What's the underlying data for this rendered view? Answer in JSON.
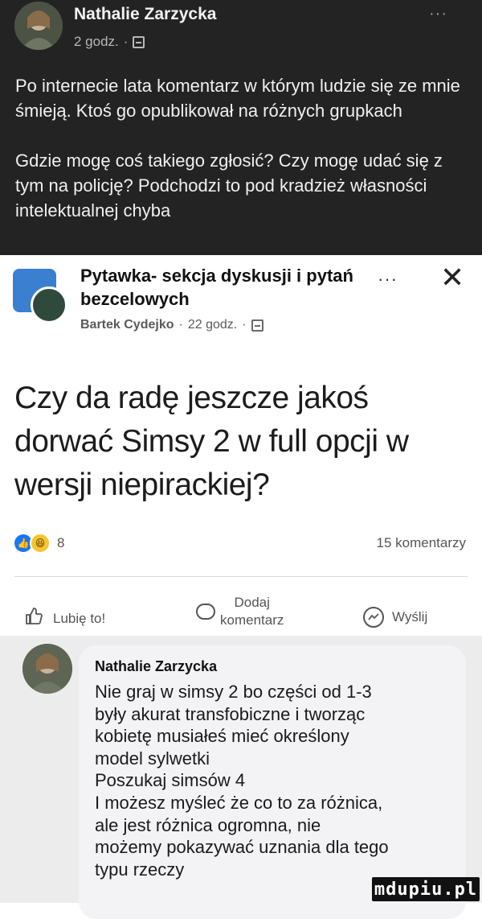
{
  "top_post": {
    "author": "Nathalie Zarzycka",
    "time": "2 godz.",
    "separator": "·",
    "more": "···",
    "paragraph1": "Po internecie lata komentarz w którym ludzie się ze mnie śmieją. Ktoś go opublikował na różnych grupkach",
    "paragraph2": "Gdzie mogę coś takiego zgłosić? Czy mogę udać się z tym na policję? Podchodzi to pod kradzież własności intelektualnej chyba"
  },
  "shared_post": {
    "group_name": "Pytawka- sekcja dyskusji i pytań bezcelowych",
    "author": "Bartek Cydejko",
    "time": "22 godz.",
    "separator": "·",
    "more": "···",
    "close": "✕",
    "question": "Czy da radę jeszcze jakoś dorwać Simsy 2 w full opcji w wersji niepirackiej?",
    "reactions_count": "8",
    "comments_count": "15 komentarzy",
    "actions": {
      "like": "Lubię to!",
      "comment_line1": "Dodaj",
      "comment_line2": "komentarz",
      "share": "Wyślij"
    }
  },
  "comment": {
    "author": "Nathalie Zarzycka",
    "lines": [
      "Nie graj w simsy 2 bo części od 1-3",
      "były akurat transfobiczne i tworząc",
      "kobietę musiałeś mieć określony",
      "model sylwetki",
      "Poszukaj simsów 4",
      "I możesz myśleć że co to za różnica,",
      "ale jest różnica ogromna, nie",
      "możemy pokazywać uznania dla tego",
      "typu rzeczy"
    ]
  },
  "watermark": "mdupiu.pl",
  "colors": {
    "dark_bg": "#232324",
    "facebook_blue": "#1877f2",
    "haha_yellow": "#f7c531",
    "comment_bg": "#ececec"
  },
  "icons": [
    "globe-icon",
    "more-icon",
    "close-icon",
    "like-reaction-icon",
    "haha-reaction-icon",
    "thumb-up-icon",
    "comment-icon",
    "messenger-icon"
  ]
}
